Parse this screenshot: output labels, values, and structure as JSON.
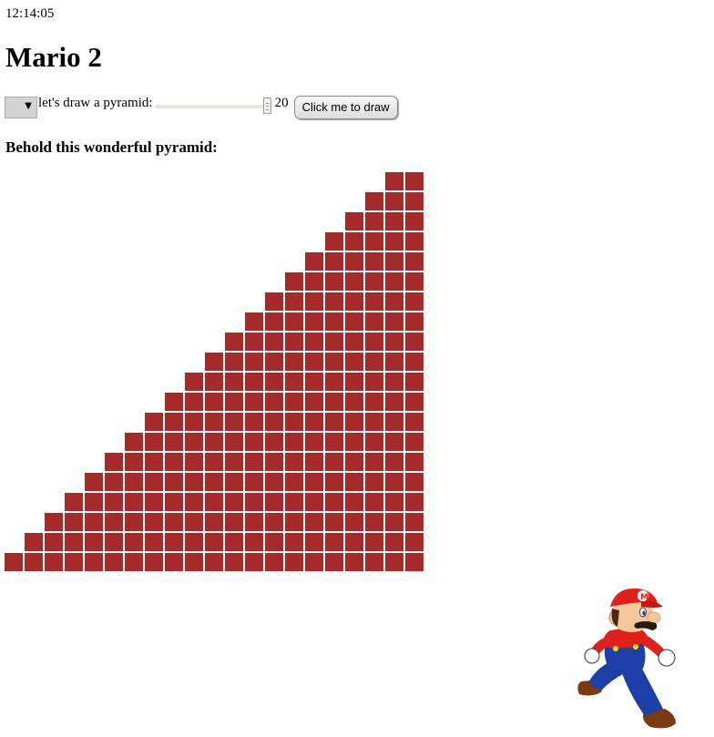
{
  "clock": "12:14:05",
  "page_title": "Mario 2",
  "controls": {
    "select_value": "",
    "pyramid_label": "let's draw a pyramid:",
    "slider_value": "20",
    "slider_min": 1,
    "slider_max": 20,
    "draw_button_label": "Click me to draw"
  },
  "subtitle": "Behold this wonderful pyramid:",
  "pyramid": {
    "height": 20,
    "brick_color": "#a52a2a",
    "mortar_color": "#ffffff"
  },
  "mario": {
    "icon": "mario-running-icon"
  }
}
